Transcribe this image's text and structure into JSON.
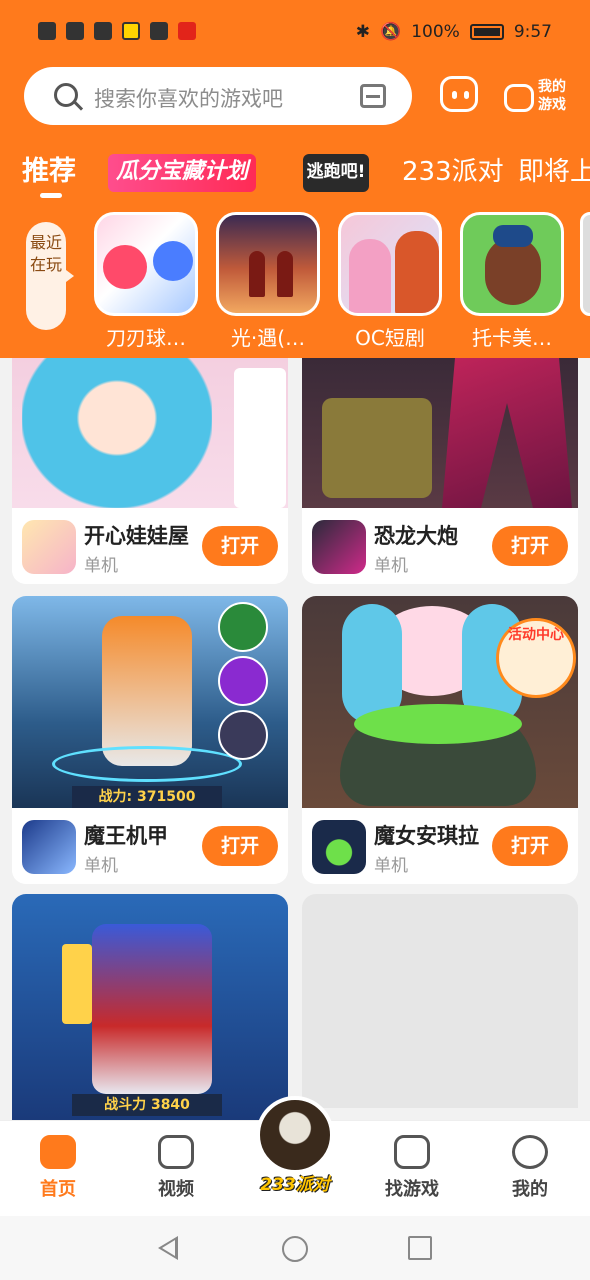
{
  "status": {
    "battery": "100%",
    "time": "9:57"
  },
  "search": {
    "placeholder": "搜索你喜欢的游戏吧"
  },
  "header": {
    "my_games_label": "我的游戏"
  },
  "tabs": [
    {
      "label": "推荐"
    },
    {
      "label": "瓜分宝藏计划"
    },
    {
      "label": "逃跑吧!"
    },
    {
      "label": "233派对"
    },
    {
      "label": "即将上"
    }
  ],
  "recent": {
    "label": "最近在玩",
    "items": [
      {
        "name": "刀刃球…"
      },
      {
        "name": "光·遇(…"
      },
      {
        "name": "OC短剧"
      },
      {
        "name": "托卡美…"
      }
    ]
  },
  "games": [
    {
      "name": "开心娃娃屋",
      "tag": "单机",
      "button": "打开"
    },
    {
      "name": "恐龙大炮",
      "tag": "单机",
      "button": "打开"
    },
    {
      "name": "魔王机甲",
      "tag": "单机",
      "button": "打开"
    },
    {
      "name": "魔女安琪拉",
      "tag": "单机",
      "button": "打开"
    }
  ],
  "card_overlays": {
    "mecha_power": "战力: 371500",
    "event_center": "活动中心",
    "robot_power": "战斗力 3840"
  },
  "bottom_nav": [
    {
      "label": "首页"
    },
    {
      "label": "视频"
    },
    {
      "label": "233派对"
    },
    {
      "label": "找游戏"
    },
    {
      "label": "我的"
    }
  ],
  "colors": {
    "brand": "#ff7a1c"
  }
}
